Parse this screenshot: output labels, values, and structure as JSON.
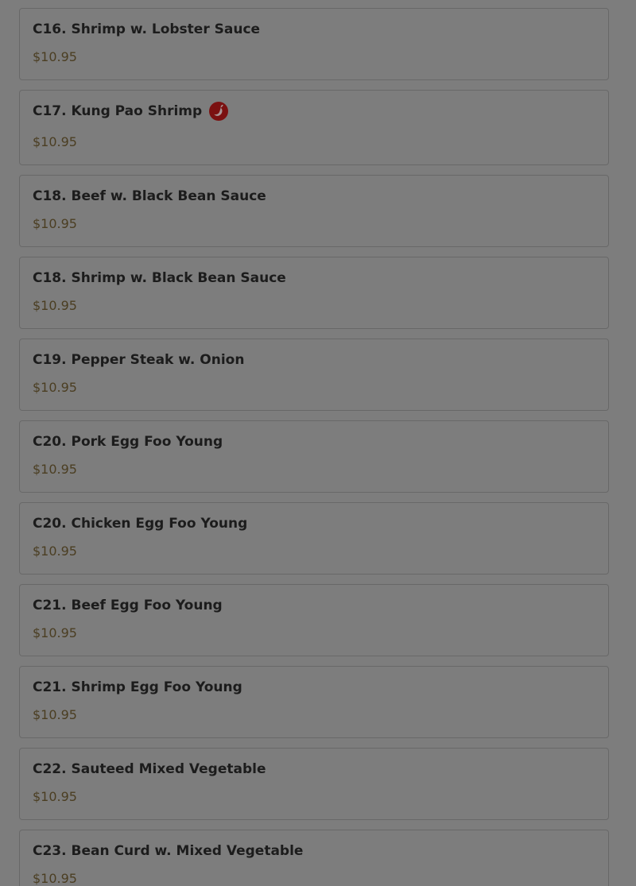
{
  "icons": {
    "spicy": "chili-pepper-icon"
  },
  "colors": {
    "overlay_background": "#7d7d7d",
    "card_border": "#686868",
    "title_text": "#1c1c1c",
    "price_text": "#4b3e22",
    "spicy_badge": "#7b1111"
  },
  "items": [
    {
      "name": "C16. Shrimp w. Lobster Sauce",
      "price": "$10.95",
      "spicy": false
    },
    {
      "name": "C17. Kung Pao Shrimp",
      "price": "$10.95",
      "spicy": true
    },
    {
      "name": "C18. Beef w. Black Bean Sauce",
      "price": "$10.95",
      "spicy": false
    },
    {
      "name": "C18. Shrimp w. Black Bean Sauce",
      "price": "$10.95",
      "spicy": false
    },
    {
      "name": "C19. Pepper Steak w. Onion",
      "price": "$10.95",
      "spicy": false
    },
    {
      "name": "C20. Pork Egg Foo Young",
      "price": "$10.95",
      "spicy": false
    },
    {
      "name": "C20. Chicken Egg Foo Young",
      "price": "$10.95",
      "spicy": false
    },
    {
      "name": "C21. Beef Egg Foo Young",
      "price": "$10.95",
      "spicy": false
    },
    {
      "name": "C21. Shrimp Egg Foo Young",
      "price": "$10.95",
      "spicy": false
    },
    {
      "name": "C22. Sauteed Mixed Vegetable",
      "price": "$10.95",
      "spicy": false
    },
    {
      "name": "C23. Bean Curd w. Mixed Vegetable",
      "price": "$10.95",
      "spicy": false
    }
  ]
}
